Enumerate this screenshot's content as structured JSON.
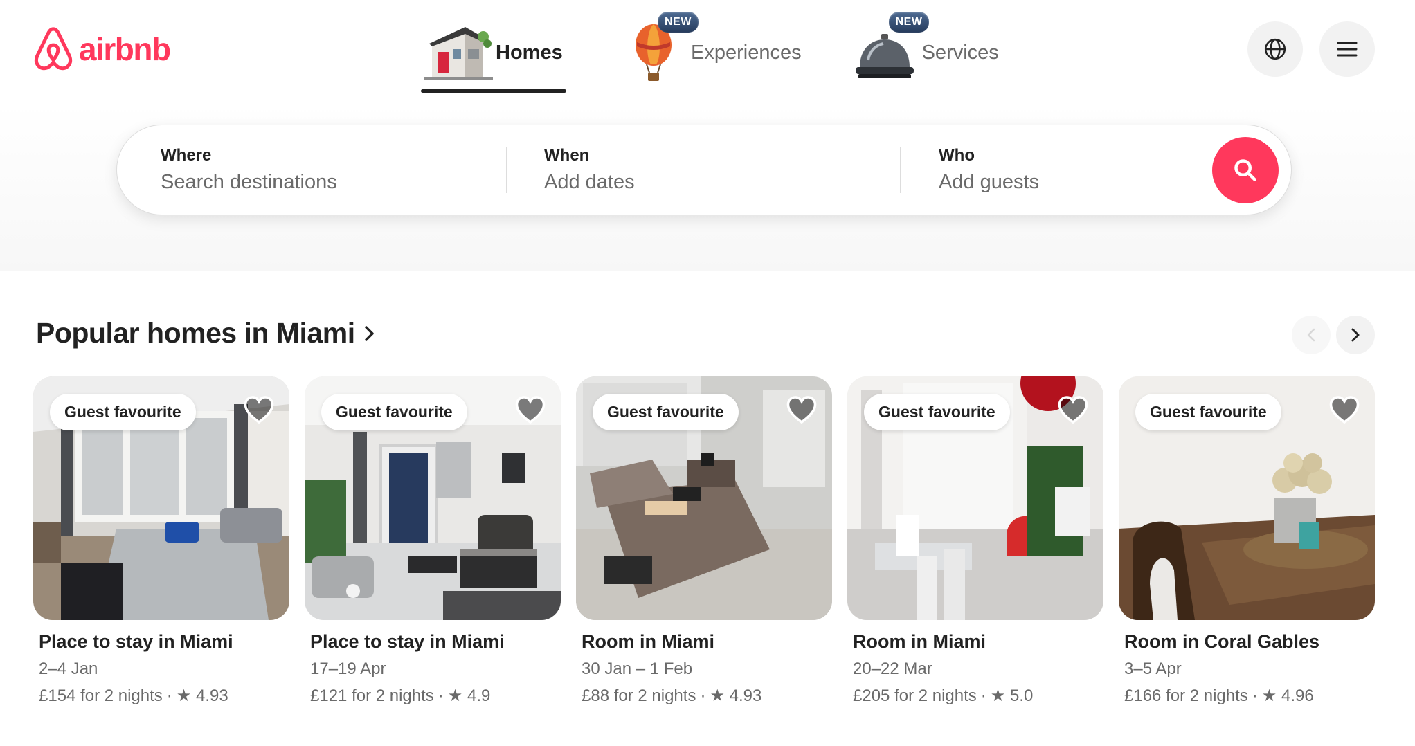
{
  "brand": {
    "name": "airbnb",
    "color": "#ff385c"
  },
  "nav": {
    "tabs": [
      {
        "label": "Homes",
        "icon": "house-icon",
        "active": true,
        "badge": ""
      },
      {
        "label": "Experiences",
        "icon": "hot-air-balloon-icon",
        "active": false,
        "badge": "NEW"
      },
      {
        "label": "Services",
        "icon": "service-bell-icon",
        "active": false,
        "badge": "NEW"
      }
    ],
    "globe_icon": "globe-icon",
    "menu_icon": "hamburger-menu-icon"
  },
  "search": {
    "where": {
      "label": "Where",
      "placeholder": "Search destinations"
    },
    "when": {
      "label": "When",
      "placeholder": "Add dates"
    },
    "who": {
      "label": "Who",
      "placeholder": "Add guests"
    },
    "button_icon": "search-icon"
  },
  "section": {
    "title": "Popular homes in Miami",
    "title_arrow": "›",
    "prev_icon": "chevron-left-icon",
    "next_icon": "chevron-right-icon"
  },
  "listings": [
    {
      "badge": "Guest favourite",
      "title": "Place to stay in Miami",
      "dates": "2–4 Jan",
      "price": "£154 for 2 nights",
      "rating": "4.93"
    },
    {
      "badge": "Guest favourite",
      "title": "Place to stay in Miami",
      "dates": "17–19 Apr",
      "price": "£121 for 2 nights",
      "rating": "4.9"
    },
    {
      "badge": "Guest favourite",
      "title": "Room in Miami",
      "dates": "30 Jan – 1 Feb",
      "price": "£88 for 2 nights",
      "rating": "4.93"
    },
    {
      "badge": "Guest favourite",
      "title": "Room in Miami",
      "dates": "20–22 Mar",
      "price": "£205 for 2 nights",
      "rating": "5.0"
    },
    {
      "badge": "Guest favourite",
      "title": "Room in Coral Gables",
      "dates": "3–5 Apr",
      "price": "£166 for 2 nights",
      "rating": "4.96"
    }
  ],
  "rating_separator": "·",
  "star_glyph": "★"
}
